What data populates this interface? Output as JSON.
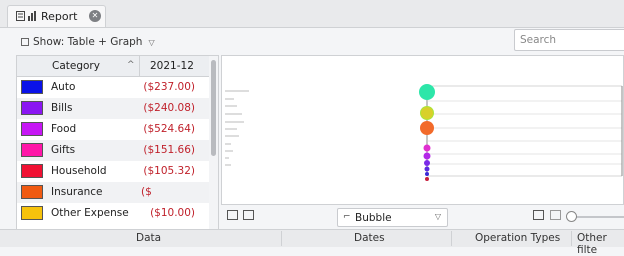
{
  "tab": {
    "label": "Report",
    "icon": "report-icon"
  },
  "toolbar": {
    "show_label": "Show: Table + Graph",
    "search_placeholder": "Search"
  },
  "table": {
    "columns": [
      "Category",
      "2021-12"
    ],
    "rows": [
      {
        "category": "Auto",
        "amount": "($237.00)",
        "color": "#0a12e8"
      },
      {
        "category": "Bills",
        "amount": "($240.08)",
        "color": "#8a16f2"
      },
      {
        "category": "Food",
        "amount": "($524.64)",
        "color": "#c617f4"
      },
      {
        "category": "Gifts",
        "amount": "($151.66)",
        "color": "#ff16a8"
      },
      {
        "category": "Household",
        "amount": "($105.32)",
        "color": "#f01133"
      },
      {
        "category": "Insurance",
        "amount": "($",
        "color": "#f05a12"
      },
      {
        "category": "Other Expense",
        "amount": "($10.00)",
        "color": "#f6c20c"
      }
    ]
  },
  "graph": {
    "chart_type": "Bubble",
    "bubble_colors": [
      "#2de6a9",
      "#a8e63a",
      "#d8d02a",
      "#f26a2a",
      "#e02fd0",
      "#b428e8",
      "#7a2ae8",
      "#5b2ae0",
      "#3c2ad8",
      "#c81e3c"
    ]
  },
  "bottom_tabs": [
    "Data",
    "Dates",
    "Operation Types",
    "Other filte"
  ]
}
